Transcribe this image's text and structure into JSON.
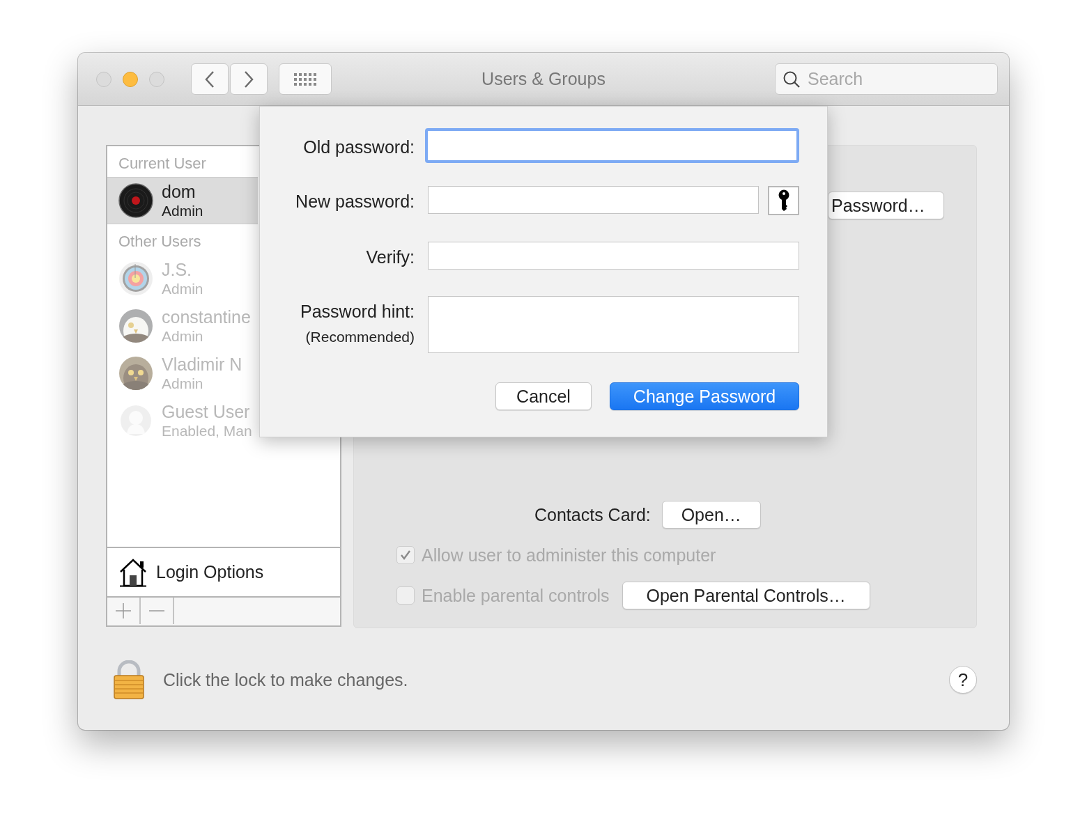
{
  "window": {
    "title": "Users & Groups",
    "traffic_lights": [
      {
        "kind": "close",
        "disabled": true
      },
      {
        "kind": "minimize",
        "disabled": false
      },
      {
        "kind": "zoom",
        "disabled": true
      }
    ]
  },
  "toolbar": {
    "search": {
      "placeholder": "Search"
    }
  },
  "sidebar": {
    "sections": [
      {
        "heading": "Current User",
        "users": [
          {
            "name": "dom",
            "role": "Admin",
            "kind": "record",
            "selected": true,
            "disabled": false
          }
        ]
      },
      {
        "heading": "Other Users",
        "users": [
          {
            "name": "J.S.",
            "role": "Admin",
            "kind": "target",
            "selected": false,
            "disabled": true
          },
          {
            "name": "constantine",
            "role": "Admin",
            "selected": false,
            "disabled": true
          },
          {
            "name": "Vladimir N",
            "role": "Admin",
            "selected": false,
            "disabled": true
          },
          {
            "name": "Guest User",
            "role": "Enabled, Man",
            "kind": "guest",
            "selected": false,
            "disabled": true
          }
        ]
      }
    ],
    "login_options": "Login Options"
  },
  "panel": {
    "password_button": "Password…",
    "contacts_label": "Contacts Card:",
    "contacts_button": "Open…",
    "checkboxes": [
      {
        "label": "Allow user to administer this computer",
        "checked": true,
        "disabled": true
      },
      {
        "label": "Enable parental controls",
        "checked": false,
        "disabled": true
      }
    ],
    "parental_button": "Open Parental Controls…"
  },
  "sheet": {
    "fields": [
      {
        "label": "Old password:",
        "kind": "single",
        "focused": true
      },
      {
        "label": "New password:",
        "kind": "with_key",
        "focused": false
      },
      {
        "label": "Verify:",
        "kind": "single",
        "focused": false
      },
      {
        "label": "Password hint:",
        "sublabel": "(Recommended)",
        "kind": "multiline",
        "focused": false
      }
    ],
    "buttons": [
      {
        "label": "Cancel",
        "default": false
      },
      {
        "label": "Change Password",
        "default": true
      }
    ]
  },
  "footer": {
    "lock_text": "Click the lock to make changes.",
    "help": "?"
  }
}
